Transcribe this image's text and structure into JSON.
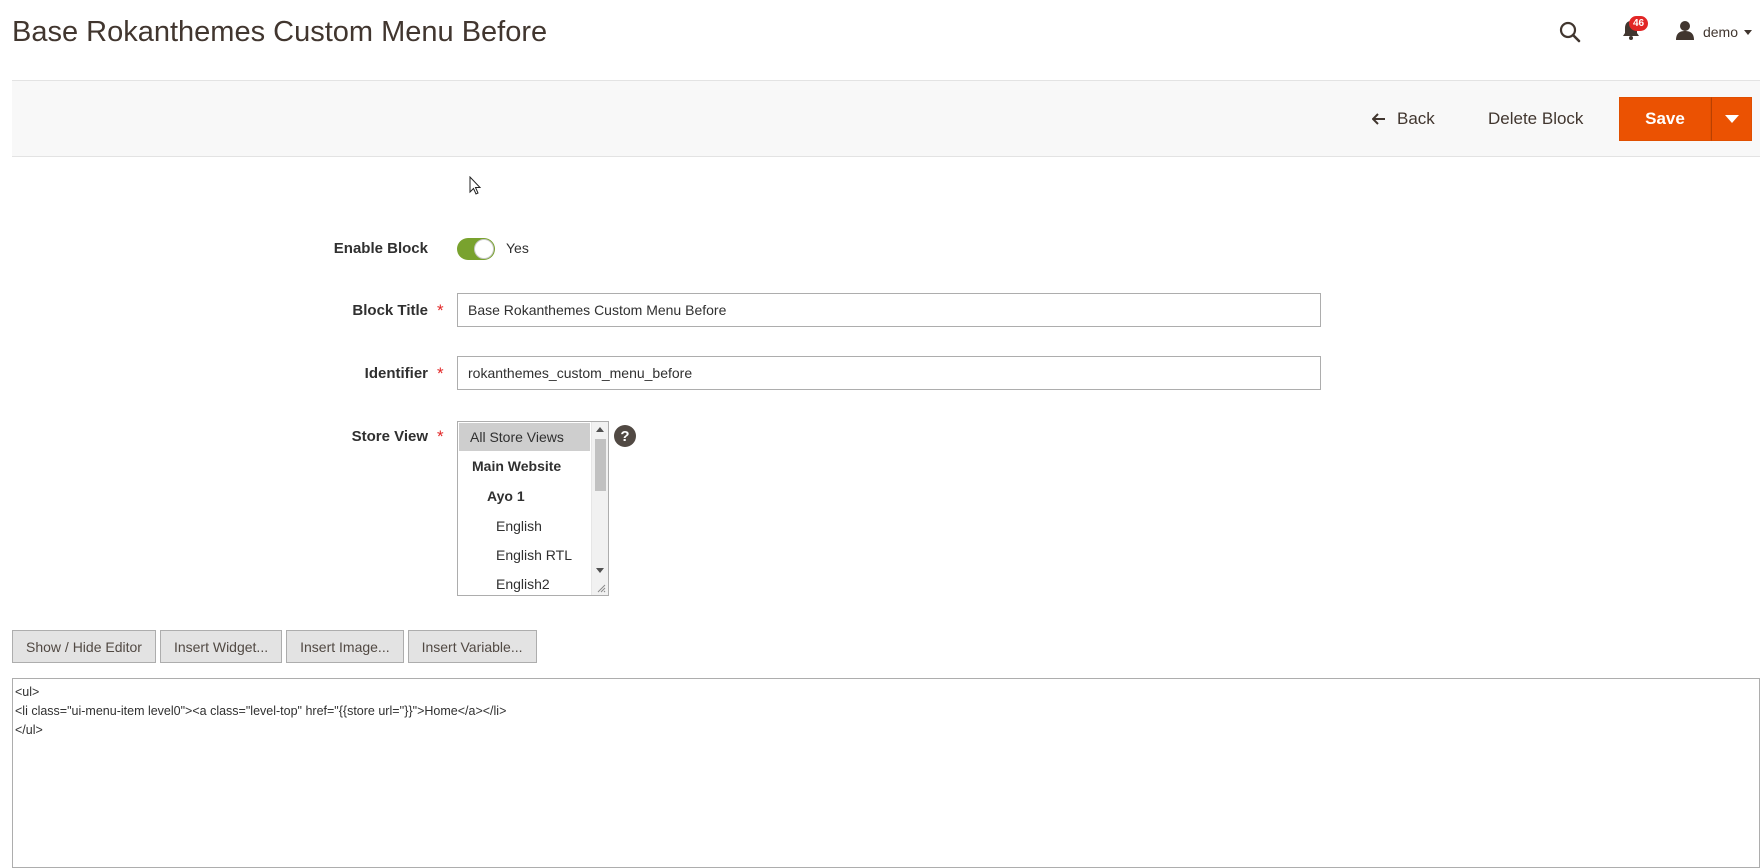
{
  "page": {
    "title": "Base Rokanthemes Custom Menu Before"
  },
  "header": {
    "search_icon": "search-icon",
    "notifications": {
      "icon": "bell-icon",
      "count": "46"
    },
    "user": {
      "icon": "user-icon",
      "name": "demo"
    }
  },
  "actions": {
    "back_label": "Back",
    "delete_label": "Delete Block",
    "save_label": "Save"
  },
  "form": {
    "enable_block": {
      "label": "Enable Block",
      "state_text": "Yes",
      "value": true
    },
    "block_title": {
      "label": "Block Title",
      "required_mark": "*",
      "value": "Base Rokanthemes Custom Menu Before"
    },
    "identifier": {
      "label": "Identifier",
      "required_mark": "*",
      "value": "rokanthemes_custom_menu_before"
    },
    "store_view": {
      "label": "Store View",
      "required_mark": "*",
      "help": "?",
      "options": [
        {
          "label": "All Store Views",
          "selected": true,
          "group": false
        },
        {
          "label": "Main Website",
          "selected": false,
          "group": true
        },
        {
          "label": "Ayo 1",
          "selected": false,
          "group": true
        },
        {
          "label": "English",
          "selected": false,
          "group": false
        },
        {
          "label": "English RTL",
          "selected": false,
          "group": false
        },
        {
          "label": "English2",
          "selected": false,
          "group": false
        }
      ]
    }
  },
  "editor": {
    "buttons": [
      "Show / Hide Editor",
      "Insert Widget...",
      "Insert Image...",
      "Insert Variable..."
    ],
    "content": "<ul>\n<li class=\"ui-menu-item level0\"><a class=\"level-top\" href=\"{{store url=''}}\">Home</a></li>\n</ul>"
  },
  "colors": {
    "accent": "#eb5202",
    "toggle_on": "#79a22e",
    "badge": "#e22626"
  }
}
